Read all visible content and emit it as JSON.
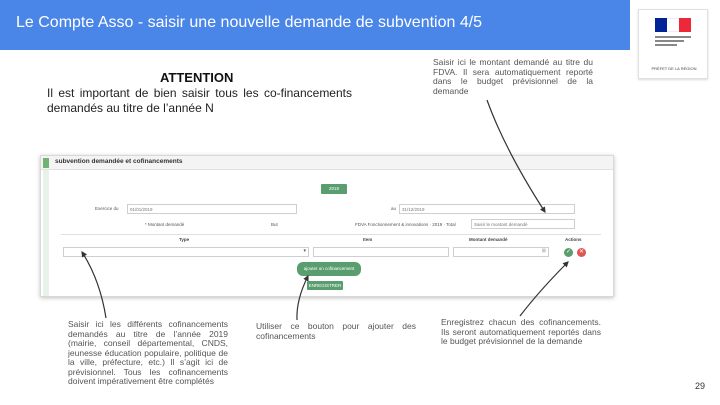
{
  "header": {
    "title": "Le Compte Asso - saisir une nouvelle demande de subvention 4/5"
  },
  "logo": {
    "flag_colors": [
      "#002395",
      "#ffffff",
      "#ed2939"
    ],
    "caption": "PRÉFET DE LA RÉGION"
  },
  "attention": {
    "title": "ATTENTION",
    "text": "Il est important de bien saisir tous les co-financements demandés au titre de l’année N"
  },
  "annotations": {
    "top": "Saisir ici le montant demandé au titre du FDVA. Il sera automatiquement reporté dans le budget prévisionnel de la demande",
    "left": "Saisir ici les différents cofinancements demandés au titre de l’année 2019 (mairie, conseil départemental, CNDS, jeunesse éducation populaire, politique de la ville, préfecture, etc.) Il s’agit ici de prévisionnel. Tous les cofinancements doivent impérativement être complétés",
    "mid": "Utiliser ce bouton pour ajouter des cofinancements",
    "right": "Enregistrez chacun des cofinancements. Ils seront automatiquement reportés dans le budget prévisionnel de la demande"
  },
  "form": {
    "section_title": "subvention demandée et cofinancements",
    "year_button": "2019",
    "from_label": "Exercice du",
    "from_value": "01/01/2019",
    "to_label": "au",
    "to_value": "31/12/2019",
    "amount_label": "* Montant demandé",
    "goal_label": "But",
    "fdva_label": "FDVA Fonctionnement & innovations · 2019 · Total",
    "amount_placeholder": "Saisir le montant demandé",
    "col_type": "Type",
    "col_item": "Item",
    "col_amount": "Montant demandé",
    "col_actions": "Actions",
    "add_button": "ajouter un cofinancement",
    "save_button": "ENREGISTRER"
  },
  "page_number": "29",
  "colors": {
    "header_bg": "#4a86e8",
    "green_button": "#5a9e6f",
    "delete_red": "#e05555"
  }
}
